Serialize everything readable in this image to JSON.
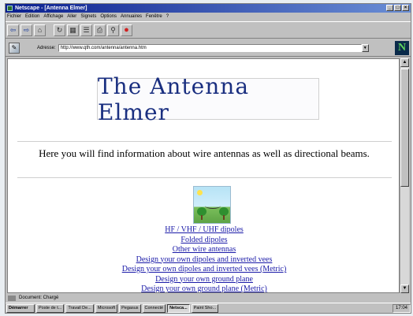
{
  "window": {
    "title": "Netscape - [Antenna Elmer]"
  },
  "menubar": [
    "Fichier",
    "Edition",
    "Affichage",
    "Aller",
    "Signets",
    "Options",
    "Annuaires",
    "Fenêtre",
    "?"
  ],
  "address": {
    "label": "Adresse:",
    "value": "http://www.qth.com/antenna/antenna.htm"
  },
  "content": {
    "title": "The Antenna Elmer",
    "intro": "Here you will find information about wire antennas as well as directional beams.",
    "links": [
      "HF / VHF / UHF dipoles",
      "Folded dipoles",
      "Other wire antennas",
      "Design your own dipoles and inverted vees",
      "Design your own dipoles and inverted vees (Metric)",
      "Design your own ground plane",
      "Design your own ground plane (Metric)"
    ]
  },
  "status": {
    "text": "Document: Chargé"
  },
  "taskbar": {
    "start": "Démarrer",
    "tasks": [
      "Poste de t...",
      "Travail De...",
      "Microsoft",
      "Pegasus",
      "Connecté",
      "Netsca...",
      "Paint Sho..."
    ],
    "active_task": "Netsca...",
    "clock": "17:04"
  },
  "colors": {
    "title_text": "#1a2f80",
    "link": "#1a1aa8",
    "titlebar": "#0a1f8f"
  }
}
